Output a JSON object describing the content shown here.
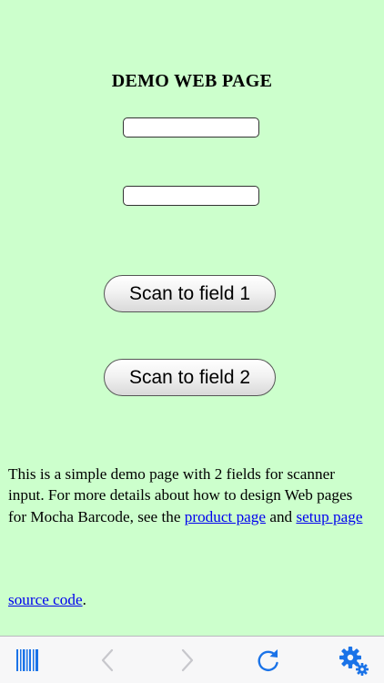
{
  "page": {
    "title": "DEMO WEB PAGE",
    "fields": [
      {
        "value": ""
      },
      {
        "value": ""
      }
    ],
    "buttons": {
      "scan1": "Scan to field 1",
      "scan2": "Scan to field 2"
    },
    "description": {
      "text1": "This is a simple demo page with 2 fields for scanner input. For more details about how to design Web pages for Mocha Barcode, see the ",
      "link_product": "product page",
      "text2": " and ",
      "link_setup": "setup page"
    },
    "source": {
      "link": "source code",
      "suffix": "."
    }
  },
  "toolbar": {
    "items": [
      {
        "icon": "barcode-icon",
        "enabled": true
      },
      {
        "icon": "back-arrow-icon",
        "enabled": false
      },
      {
        "icon": "forward-arrow-icon",
        "enabled": false
      },
      {
        "icon": "reload-icon",
        "enabled": true
      },
      {
        "icon": "settings-gears-icon",
        "enabled": true
      }
    ],
    "accent_color": "#1a73e8",
    "disabled_color": "#c7c7cc"
  }
}
